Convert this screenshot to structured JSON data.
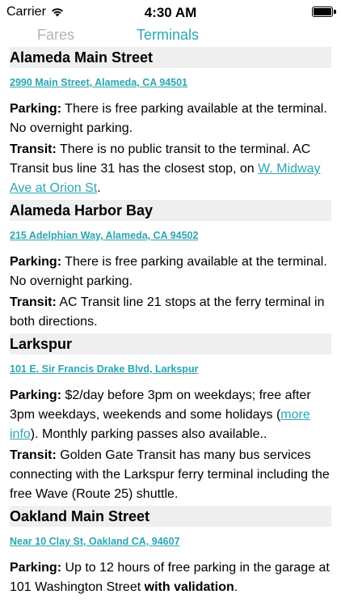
{
  "status": {
    "carrier": "Carrier",
    "time": "4:30 AM"
  },
  "tabs": {
    "fares": "Fares",
    "terminals": "Terminals"
  },
  "terminals": [
    {
      "name": "Alameda Main Street",
      "address": "2990 Main Street, Alameda, CA 94501",
      "parking_label": "Parking:",
      "parking_text": " There is free parking available at the terminal. No overnight parking.",
      "transit_label": "Transit:",
      "transit_text": " There is no public transit to the terminal. AC Transit bus line 31 has the closest stop, on ",
      "transit_link": "W. Midway Ave at Orion St",
      "transit_after": "."
    },
    {
      "name": "Alameda Harbor Bay",
      "address": "215 Adelphian Way, Alameda, CA 94502",
      "parking_label": "Parking:",
      "parking_text": " There is free parking available at the terminal. No overnight parking.",
      "transit_label": "Transit:",
      "transit_text": " AC Transit line 21 stops at the ferry terminal in both directions."
    },
    {
      "name": "Larkspur",
      "address": "101 E. Sir Francis Drake Blvd, Larkspur",
      "parking_label": "Parking:",
      "parking_text": " $2/day before 3pm on weekdays; free after 3pm weekdays, weekends and some holidays (",
      "parking_link": "more info",
      "parking_after": "). Monthly parking passes also available..",
      "transit_label": "Transit:",
      "transit_text": " Golden Gate Transit has many bus services connecting with the Larkspur ferry terminal including the free Wave (Route 25) shuttle."
    },
    {
      "name": "Oakland Main Street",
      "address": "Near 10 Clay St, Oakland CA, 94607",
      "parking_label": "Parking:",
      "parking_text": " Up to 12 hours of free parking in the garage at 101 Washington Street ",
      "parking_bold": "with validation",
      "parking_after": "."
    }
  ]
}
